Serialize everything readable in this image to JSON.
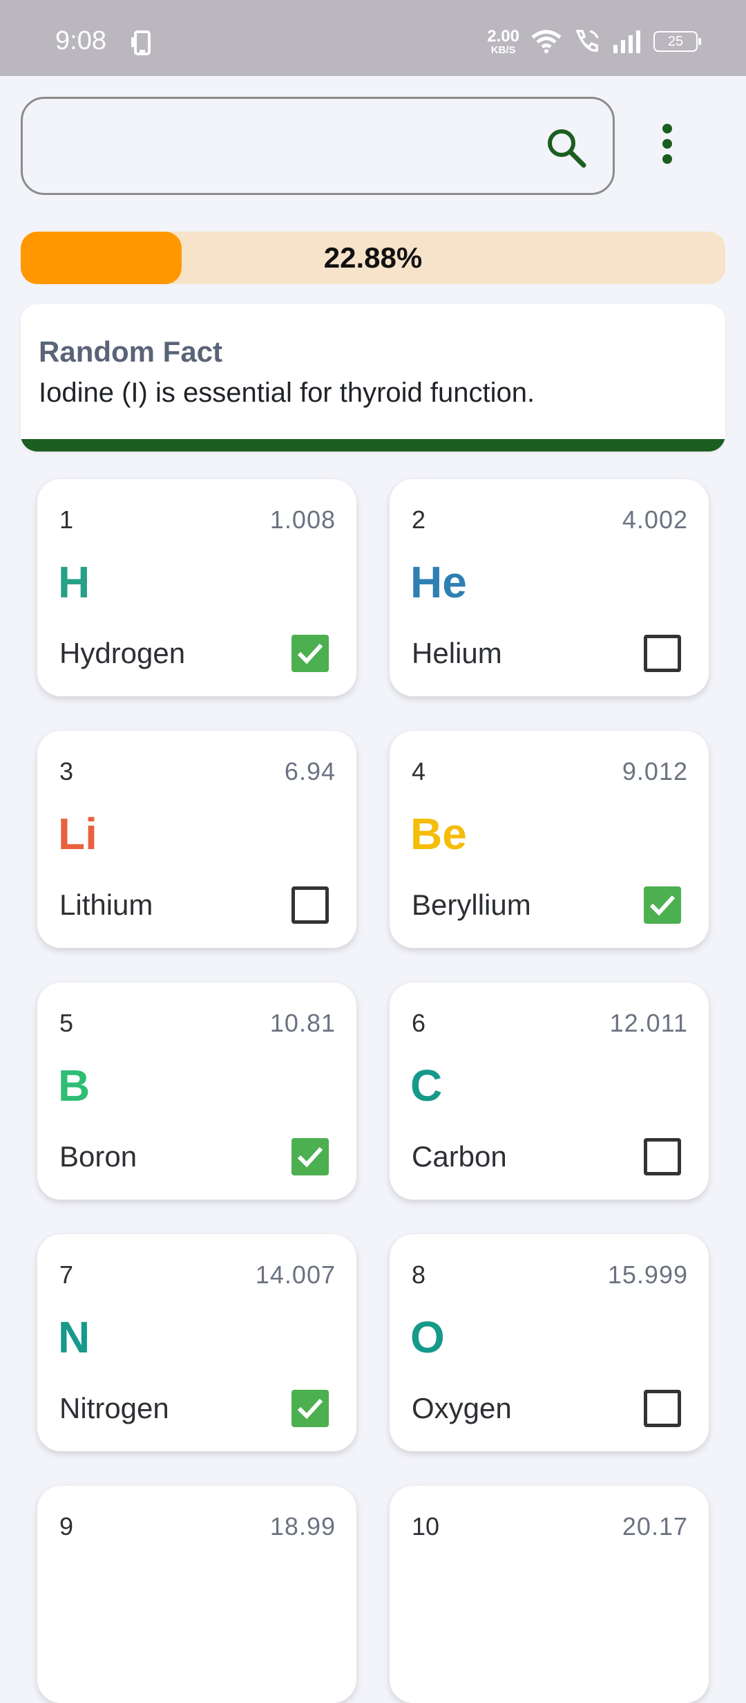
{
  "status_bar": {
    "time": "9:08",
    "net_speed_value": "2.00",
    "net_speed_unit": "KB/S",
    "battery": "25"
  },
  "search": {
    "placeholder": "",
    "value": ""
  },
  "progress": {
    "label": "22.88%",
    "percent": 22.88,
    "fill_color": "#ff9800",
    "track_color": "#f7e3c9"
  },
  "fact": {
    "title": "Random Fact",
    "text": "Iodine (I) is essential for thyroid function.",
    "accent_color": "#1b5e20"
  },
  "elements": [
    {
      "number": "1",
      "mass": "1.008",
      "symbol": "H",
      "name": "Hydrogen",
      "color": "#26a087",
      "checked": true
    },
    {
      "number": "2",
      "mass": "4.002",
      "symbol": "He",
      "name": "Helium",
      "color": "#2f7fb3",
      "checked": false
    },
    {
      "number": "3",
      "mass": "6.94",
      "symbol": "Li",
      "name": "Lithium",
      "color": "#e8623f",
      "checked": false
    },
    {
      "number": "4",
      "mass": "9.012",
      "symbol": "Be",
      "name": "Beryllium",
      "color": "#f5bd0a",
      "checked": true
    },
    {
      "number": "5",
      "mass": "10.81",
      "symbol": "B",
      "name": "Boron",
      "color": "#2ebd73",
      "checked": true
    },
    {
      "number": "6",
      "mass": "12.011",
      "symbol": "C",
      "name": "Carbon",
      "color": "#16998a",
      "checked": false
    },
    {
      "number": "7",
      "mass": "14.007",
      "symbol": "N",
      "name": "Nitrogen",
      "color": "#16998a",
      "checked": true
    },
    {
      "number": "8",
      "mass": "15.999",
      "symbol": "O",
      "name": "Oxygen",
      "color": "#16998a",
      "checked": false
    },
    {
      "number": "9",
      "mass": "18.99",
      "symbol": "",
      "name": "",
      "color": "#16998a",
      "checked": false
    },
    {
      "number": "10",
      "mass": "20.17",
      "symbol": "",
      "name": "",
      "color": "#16998a",
      "checked": false
    }
  ],
  "icons": {
    "search": "search-icon",
    "more": "more-vert-icon",
    "check": "checkmark-icon"
  }
}
